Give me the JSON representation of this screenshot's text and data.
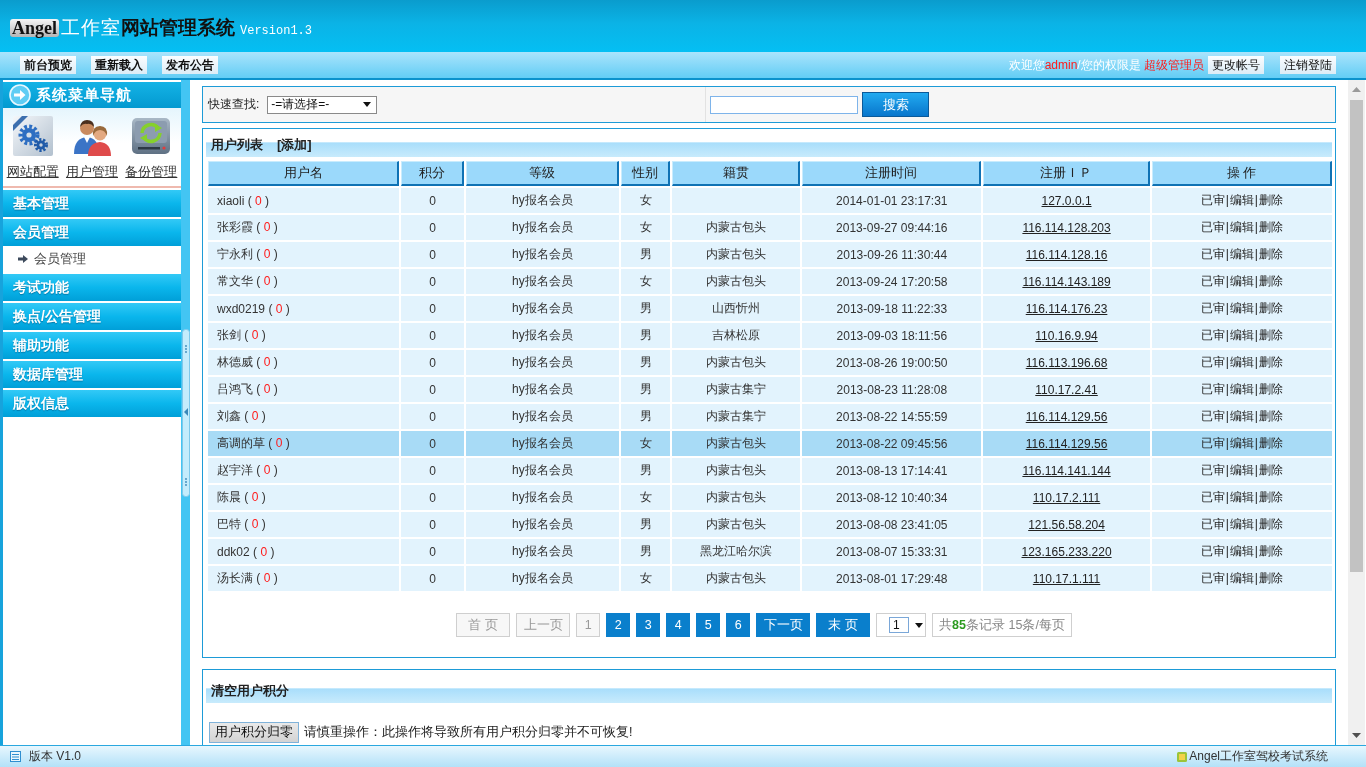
{
  "header": {
    "logo_badge": "Angel",
    "logo_studio": "工作室",
    "title": "网站管理系统",
    "version": "Version1.3"
  },
  "toolbar": {
    "buttons": [
      "前台预览",
      "重新载入",
      "发布公告"
    ],
    "welcome": {
      "greeting": "欢迎您",
      "user": "admin",
      "role_label": "/您的权限是",
      "role": "超级管理员"
    },
    "account_buttons": [
      "更改帐号",
      "注销登陆"
    ]
  },
  "sidebar": {
    "title": "系统菜单导航",
    "shortcuts": [
      {
        "kind": "gears",
        "label": "网站配置"
      },
      {
        "kind": "users",
        "label": "用户管理"
      },
      {
        "kind": "backup",
        "label": "备份管理"
      }
    ],
    "menu": [
      {
        "label": "基本管理"
      },
      {
        "label": "会员管理",
        "children": [
          {
            "label": "会员管理"
          }
        ]
      },
      {
        "label": "考试功能"
      },
      {
        "label": "换点/公告管理"
      },
      {
        "label": "辅助功能"
      },
      {
        "label": "数据库管理"
      },
      {
        "label": "版权信息"
      }
    ]
  },
  "search": {
    "label": "快速查找:",
    "select_value": "-=请选择=-",
    "button": "搜索"
  },
  "users": {
    "title": "用户列表",
    "add_link": "[添加]",
    "columns": [
      "用户名",
      "积分",
      "等级",
      "性别",
      "籍贯",
      "注册时间",
      "注册ＩＰ",
      "操 作"
    ],
    "rows": [
      {
        "selected": false,
        "user": {
          "name": "xiaoli",
          "open": "(",
          "points": "0",
          "close": ")"
        },
        "score": "0",
        "grade": "hy报名会员",
        "gender": "女",
        "registered": "2014-01-01 23:17:31",
        "ip": "127.0.0.1",
        "actions": [
          "已审",
          "|",
          "编辑",
          "|",
          "删除"
        ]
      },
      {
        "selected": false,
        "user": {
          "name": "张彩霞",
          "open": "(",
          "points": "0",
          "close": ")"
        },
        "score": "0",
        "grade": "hy报名会员",
        "gender": "女",
        "hometown": "内蒙古包头",
        "registered": "2013-09-27 09:44:16",
        "ip": "116.114.128.203",
        "actions": [
          "已审",
          "|",
          "编辑",
          "|",
          "删除"
        ]
      },
      {
        "selected": false,
        "user": {
          "name": "宁永利",
          "open": "(",
          "points": "0",
          "close": ")"
        },
        "score": "0",
        "grade": "hy报名会员",
        "gender": "男",
        "hometown": "内蒙古包头",
        "registered": "2013-09-26 11:30:44",
        "ip": "116.114.128.16",
        "actions": [
          "已审",
          "|",
          "编辑",
          "|",
          "删除"
        ]
      },
      {
        "selected": false,
        "user": {
          "name": "常文华",
          "open": "(",
          "points": "0",
          "close": ")"
        },
        "score": "0",
        "grade": "hy报名会员",
        "gender": "女",
        "hometown": "内蒙古包头",
        "registered": "2013-09-24 17:20:58",
        "ip": "116.114.143.189",
        "actions": [
          "已审",
          "|",
          "编辑",
          "|",
          "删除"
        ]
      },
      {
        "selected": false,
        "user": {
          "name": "wxd0219",
          "open": "(",
          "points": "0",
          "close": ")"
        },
        "score": "0",
        "grade": "hy报名会员",
        "gender": "男",
        "hometown": "山西忻州",
        "registered": "2013-09-18 11:22:33",
        "ip": "116.114.176.23",
        "actions": [
          "已审",
          "|",
          "编辑",
          "|",
          "删除"
        ]
      },
      {
        "selected": false,
        "user": {
          "name": "张剑",
          "open": "(",
          "points": "0",
          "close": ")"
        },
        "score": "0",
        "grade": "hy报名会员",
        "gender": "男",
        "hometown": "吉林松原",
        "registered": "2013-09-03 18:11:56",
        "ip": "110.16.9.94",
        "actions": [
          "已审",
          "|",
          "编辑",
          "|",
          "删除"
        ]
      },
      {
        "selected": false,
        "user": {
          "name": "林德威",
          "open": "(",
          "points": "0",
          "close": ")"
        },
        "score": "0",
        "grade": "hy报名会员",
        "gender": "男",
        "hometown": "内蒙古包头",
        "registered": "2013-08-26 19:00:50",
        "ip": "116.113.196.68",
        "actions": [
          "已审",
          "|",
          "编辑",
          "|",
          "删除"
        ]
      },
      {
        "selected": false,
        "user": {
          "name": "吕鸿飞",
          "open": "(",
          "points": "0",
          "close": ")"
        },
        "score": "0",
        "grade": "hy报名会员",
        "gender": "男",
        "hometown": "内蒙古集宁",
        "registered": "2013-08-23 11:28:08",
        "ip": "110.17.2.41",
        "actions": [
          "已审",
          "|",
          "编辑",
          "|",
          "删除"
        ]
      },
      {
        "selected": false,
        "user": {
          "name": "刘鑫",
          "open": "(",
          "points": "0",
          "close": ")"
        },
        "score": "0",
        "grade": "hy报名会员",
        "gender": "男",
        "hometown": "内蒙古集宁",
        "registered": "2013-08-22 14:55:59",
        "ip": "116.114.129.56",
        "actions": [
          "已审",
          "|",
          "编辑",
          "|",
          "删除"
        ]
      },
      {
        "selected": true,
        "user": {
          "name": "高调的草",
          "open": "(",
          "points": "0",
          "close": ")"
        },
        "score": "0",
        "grade": "hy报名会员",
        "gender": "女",
        "hometown": "内蒙古包头",
        "registered": "2013-08-22 09:45:56",
        "ip": "116.114.129.56",
        "actions": [
          "已审",
          "|",
          "编辑",
          "|",
          "删除"
        ]
      },
      {
        "selected": false,
        "user": {
          "name": "赵宇洋",
          "open": "(",
          "points": "0",
          "close": ")"
        },
        "score": "0",
        "grade": "hy报名会员",
        "gender": "男",
        "hometown": "内蒙古包头",
        "registered": "2013-08-13 17:14:41",
        "ip": "116.114.141.144",
        "actions": [
          "已审",
          "|",
          "编辑",
          "|",
          "删除"
        ]
      },
      {
        "selected": false,
        "user": {
          "name": "陈晨",
          "open": "(",
          "points": "0",
          "close": ")"
        },
        "score": "0",
        "grade": "hy报名会员",
        "gender": "女",
        "hometown": "内蒙古包头",
        "registered": "2013-08-12 10:40:34",
        "ip": "110.17.2.111",
        "actions": [
          "已审",
          "|",
          "编辑",
          "|",
          "删除"
        ]
      },
      {
        "selected": false,
        "user": {
          "name": "巴特",
          "open": "(",
          "points": "0",
          "close": ")"
        },
        "score": "0",
        "grade": "hy报名会员",
        "gender": "男",
        "hometown": "内蒙古包头",
        "registered": "2013-08-08 23:41:05",
        "ip": "121.56.58.204",
        "actions": [
          "已审",
          "|",
          "编辑",
          "|",
          "删除"
        ]
      },
      {
        "selected": false,
        "user": {
          "name": "ddk02",
          "open": "(",
          "points": "0",
          "close": ")"
        },
        "score": "0",
        "grade": "hy报名会员",
        "gender": "男",
        "hometown": "黑龙江哈尔滨",
        "registered": "2013-08-07 15:33:31",
        "ip": "123.165.233.220",
        "actions": [
          "已审",
          "|",
          "编辑",
          "|",
          "删除"
        ]
      },
      {
        "selected": false,
        "user": {
          "name": "汤长满",
          "open": "(",
          "points": "0",
          "close": ")"
        },
        "score": "0",
        "grade": "hy报名会员",
        "gender": "女",
        "hometown": "内蒙古包头",
        "registered": "2013-08-01 17:29:48",
        "ip": "110.17.1.111",
        "actions": [
          "已审",
          "|",
          "编辑",
          "|",
          "删除"
        ]
      }
    ],
    "pager": {
      "items": [
        {
          "kind": "nav",
          "label": "首 页",
          "disabled": true
        },
        {
          "kind": "nav",
          "label": "上一页",
          "disabled": true
        },
        {
          "kind": "page",
          "label": "1",
          "selected": true
        },
        {
          "kind": "page",
          "label": "2",
          "selected": false
        },
        {
          "kind": "page",
          "label": "3",
          "selected": false
        },
        {
          "kind": "page",
          "label": "4",
          "selected": false
        },
        {
          "kind": "page",
          "label": "5",
          "selected": false
        },
        {
          "kind": "page",
          "label": "6",
          "selected": false
        },
        {
          "kind": "nav",
          "label": "下一页",
          "disabled": false
        },
        {
          "kind": "nav",
          "label": "末 页",
          "disabled": false
        }
      ],
      "page_select": "1",
      "summary": {
        "prefix": "共",
        "count": "85",
        "suffix": "条记录 15条/每页"
      }
    }
  },
  "reset_panel": {
    "title": "清空用户积分",
    "button": "用户积分归零",
    "warning": "请慎重操作：此操作将导致所有用户积分归零并不可恢复!"
  },
  "status_bar": {
    "version": "版本 V1.0",
    "app_name": "Angel工作室驾校考试系统"
  }
}
